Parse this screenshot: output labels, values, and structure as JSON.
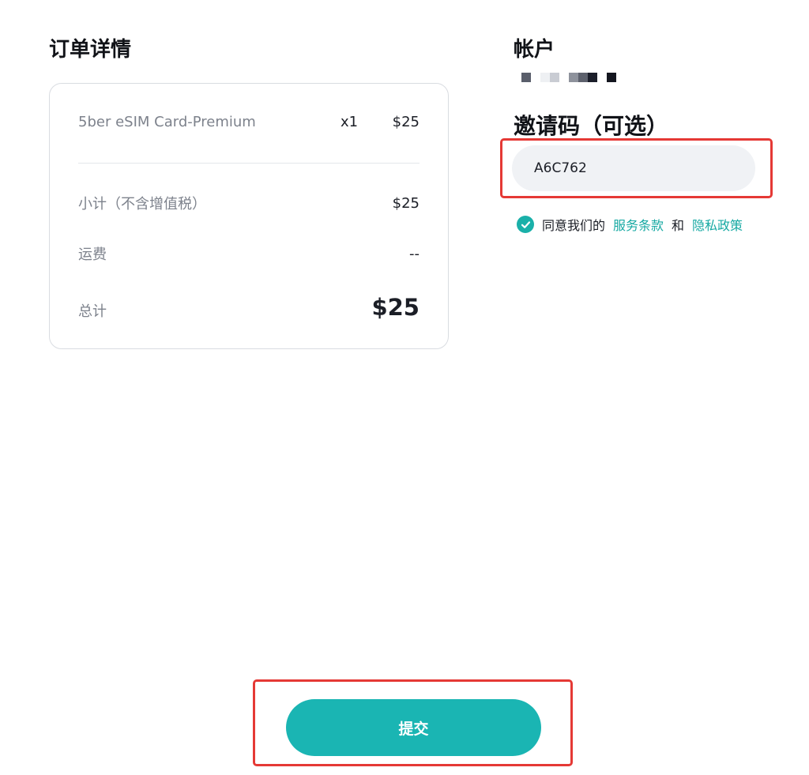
{
  "order": {
    "title": "订单详情",
    "item": {
      "name": "5ber eSIM Card-Premium",
      "quantity": "x1",
      "price": "$25"
    },
    "subtotal_label": "小计（不含增值税）",
    "subtotal_value": "$25",
    "shipping_label": "运费",
    "shipping_value": "--",
    "total_label": "总计",
    "total_value": "$25"
  },
  "account": {
    "title": "帐户",
    "masked_value_colors": [
      "#5a5e6b",
      "#ffffff",
      "#eef0f3",
      "#c9ccd3",
      "#ffffff",
      "#8e929c",
      "#5d616d",
      "#1b1e2a",
      "#ffffff",
      "#14161f"
    ]
  },
  "invite": {
    "title": "邀请码（可选）",
    "value": "A6C762"
  },
  "agreement": {
    "prefix": "同意我们的",
    "terms_link": "服务条款",
    "conjunction": "和",
    "privacy_link": "隐私政策",
    "checked": true
  },
  "submit": {
    "label": "提交"
  },
  "colors": {
    "accent": "#1ab5b3",
    "link": "#17a9a3",
    "highlight": "#e53935"
  }
}
